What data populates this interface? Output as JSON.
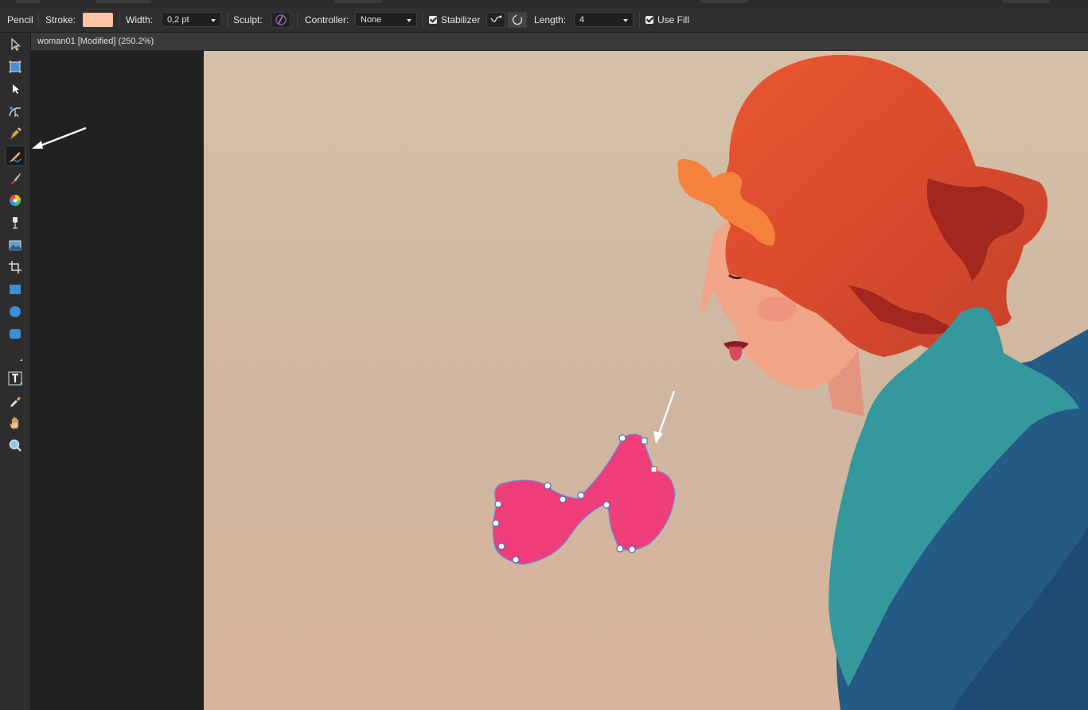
{
  "toolbar_context": {
    "tool_name": "Pencil",
    "stroke_label": "Stroke:",
    "width_label": "Width:",
    "width_value": "0,2 pt",
    "sculpt_label": "Sculpt:",
    "controller_label": "Controller:",
    "controller_value": "None",
    "stabilizer_label": "Stabilizer",
    "stabilizer_checked": true,
    "length_label": "Length:",
    "length_value": "4",
    "use_fill_label": "Use Fill",
    "use_fill_checked": true,
    "stroke_color": "#ffc4a4"
  },
  "document": {
    "tab_title": "woman01 [Modified] (250.2%)"
  },
  "tools": [
    {
      "name": "move-tool",
      "icon": "pointer-arrow-icon"
    },
    {
      "name": "artboard-tool",
      "icon": "artboard-icon"
    },
    {
      "name": "node-tool",
      "icon": "node-arrow-icon"
    },
    {
      "name": "corner-tool",
      "icon": "corner-curve-icon"
    },
    {
      "name": "pen-tool",
      "icon": "pen-nib-icon"
    },
    {
      "name": "pencil-tool",
      "icon": "pencil-icon",
      "active": true
    },
    {
      "name": "vector-brush-tool",
      "icon": "brush-icon"
    },
    {
      "name": "fill-tool",
      "icon": "color-wheel-icon"
    },
    {
      "name": "transparency-tool",
      "icon": "wine-glass-icon"
    },
    {
      "name": "place-image-tool",
      "icon": "image-icon"
    },
    {
      "name": "crop-tool",
      "icon": "crop-icon"
    },
    {
      "name": "rectangle-tool",
      "icon": "rectangle-icon"
    },
    {
      "name": "ellipse-tool",
      "icon": "ellipse-icon"
    },
    {
      "name": "rounded-rectangle-tool",
      "icon": "rounded-rectangle-icon"
    },
    {
      "name": "crescent-tool",
      "icon": "crescent-icon"
    },
    {
      "name": "text-tool",
      "icon": "text-icon"
    },
    {
      "name": "color-picker-tool",
      "icon": "eyedropper-icon"
    },
    {
      "name": "view-tool",
      "icon": "hand-icon"
    },
    {
      "name": "zoom-tool",
      "icon": "magnifier-icon"
    }
  ],
  "colors": {
    "ui_background": "#2d2d2d",
    "canvas_beige": "#d2bea5",
    "hair_orange": "#e4522e",
    "hair_highlight": "#f5823c",
    "hair_shadow": "#a2271f",
    "skin": "#f2a486",
    "scarf_teal": "#34989c",
    "coat_blue": "#245a86",
    "pink_shape": "#ee3d79",
    "path_outline": "#6a8fe0"
  }
}
